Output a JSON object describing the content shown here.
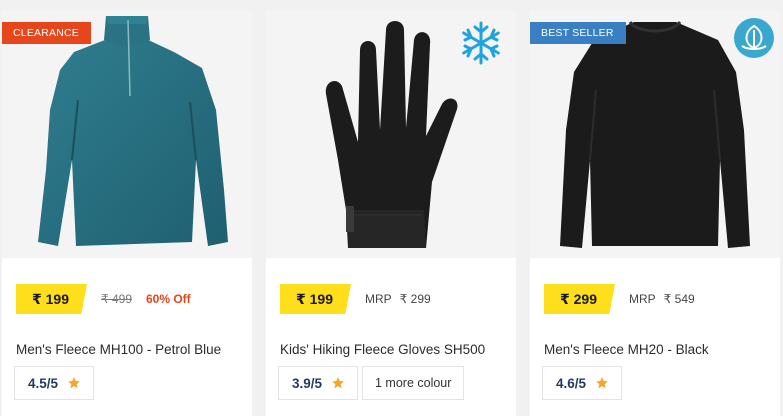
{
  "products": [
    {
      "badge": "CLEARANCE",
      "price": "₹ 199",
      "old_price": "₹ 499",
      "discount": "60% Off",
      "title": "Men's Fleece MH100 - Petrol Blue",
      "rating": "4.5/5",
      "image_icon": "petrol-blue-fleece-image"
    },
    {
      "corner_icon": "snowflake-icon",
      "price": "₹ 199",
      "mrp_label": "MRP",
      "mrp_value": "₹ 299",
      "title": "Kids' Hiking Fleece Gloves SH500",
      "rating": "3.9/5",
      "more_colour": "1 more colour",
      "image_icon": "black-glove-image"
    },
    {
      "badge": "BEST SELLER",
      "corner_icon": "eco-leaf-icon",
      "price": "₹ 299",
      "mrp_label": "MRP",
      "mrp_value": "₹ 549",
      "title": "Men's Fleece MH20 - Black",
      "rating": "4.6/5",
      "image_icon": "black-fleece-image"
    }
  ],
  "colors": {
    "price_highlight": "#ffdf1b",
    "clearance_badge": "#e5461c",
    "bestseller_badge": "#3a7fc1",
    "discount_text": "#e5461c",
    "rating_text": "#243b5e",
    "star": "#f5a623",
    "snowflake": "#1fa3dc"
  }
}
